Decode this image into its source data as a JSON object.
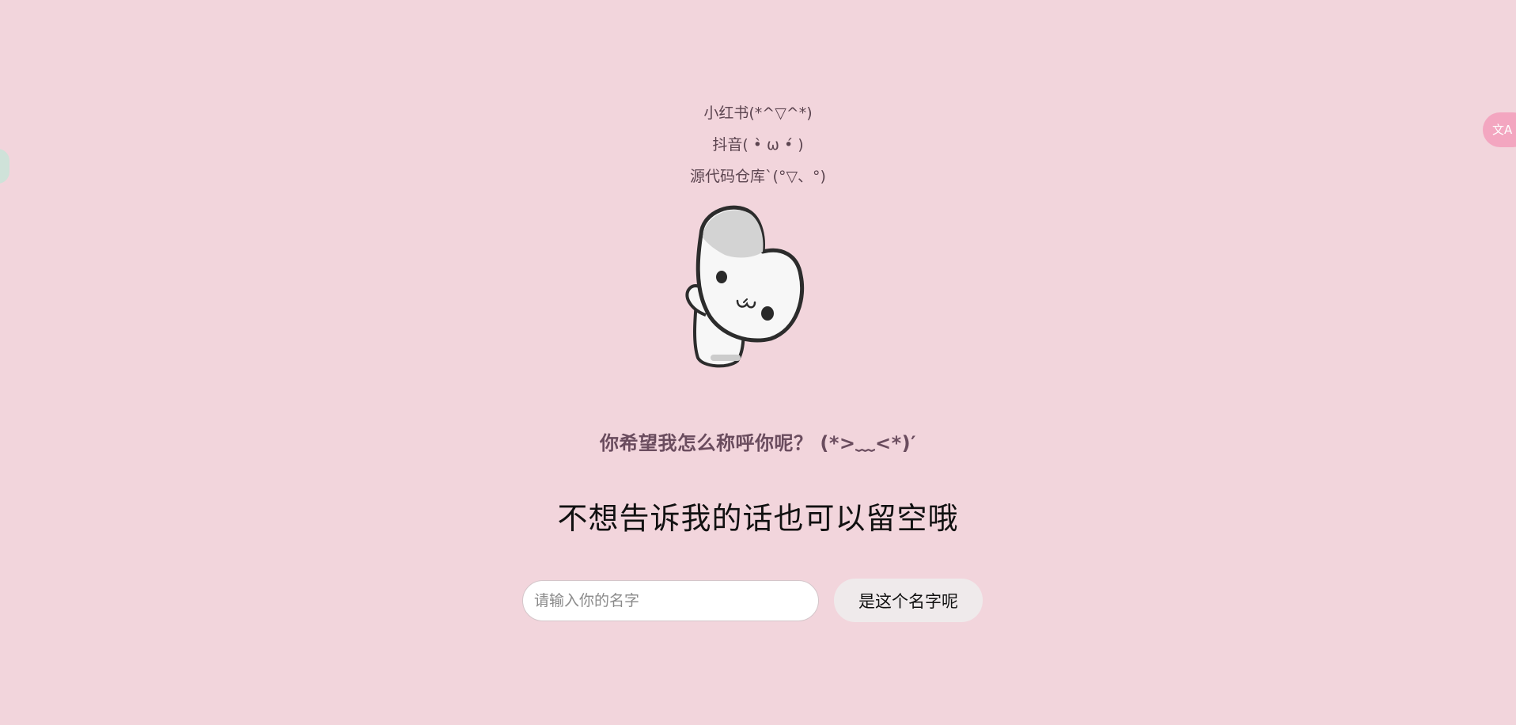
{
  "links": {
    "xiaohongshu": "小红书(*^▽^*)",
    "douyin": "抖音( •̀ ω •́ )",
    "source_repo": "源代码仓库`(°▽、°)"
  },
  "mascot": {
    "icon": "waving-mascot-illustration"
  },
  "question": "你希望我怎么称呼你呢？ (*>﹏<*)′",
  "hint": "不想告诉我的话也可以留空哦",
  "form": {
    "name_placeholder": "请输入你的名字",
    "name_value": "",
    "confirm_label": "是这个名字呢"
  },
  "translate_tab": {
    "icon": "translate-icon",
    "label": "文A"
  },
  "colors": {
    "background": "#f2d5dc",
    "link_text": "#5c4550",
    "question_text": "#6a4c5e",
    "button_bg": "#efeaeb",
    "translate_bg": "#f3a6c0"
  }
}
